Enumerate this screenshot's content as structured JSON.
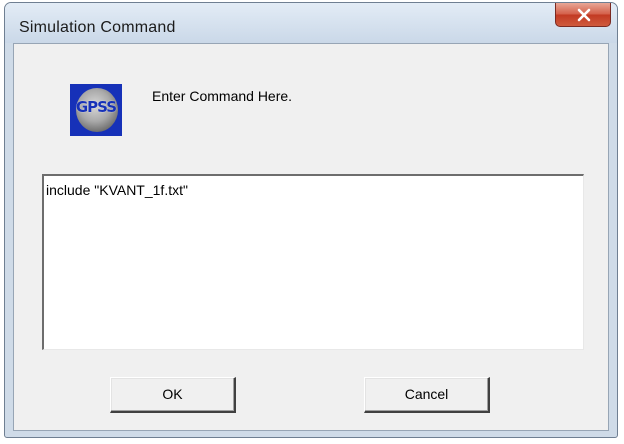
{
  "window": {
    "title": "Simulation Command"
  },
  "icons": {
    "app_icon": "gpss-globe-icon",
    "app_icon_text": "GPSS",
    "close_icon": "close-icon"
  },
  "dialog": {
    "prompt": "Enter Command Here.",
    "command_value": "include \"KVANT_1f.txt\""
  },
  "buttons": {
    "ok_label": "OK",
    "cancel_label": "Cancel"
  },
  "colors": {
    "close_button": "#c9452d",
    "icon_background": "#1631b8",
    "dialog_background": "#f0f0f0",
    "frame": "#cfdbe8"
  }
}
